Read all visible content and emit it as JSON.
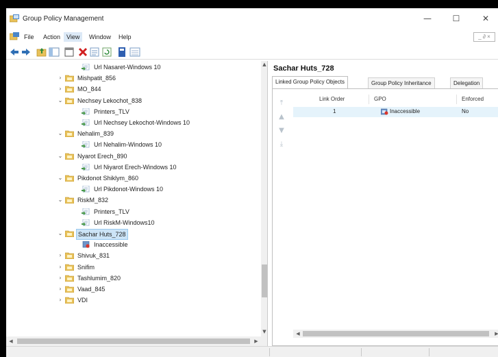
{
  "window": {
    "title": "Group Policy Management",
    "controls": {
      "minimize": "—",
      "maximize": "☐",
      "close": "✕"
    }
  },
  "menu": {
    "items": [
      "File",
      "Action",
      "View",
      "Window",
      "Help"
    ],
    "active": "View",
    "mdi_controls": "_ ∂ ×"
  },
  "toolbar": {
    "buttons": [
      "back-icon",
      "forward-icon",
      "up-folder-icon",
      "show-hide-tree-icon",
      "console-icon",
      "delete-icon",
      "properties-icon",
      "refresh-icon",
      "help-icon",
      "list-view-icon"
    ]
  },
  "tree": {
    "rows": [
      {
        "label": "Url Nasaret-Windows 10",
        "kind": "gpo-link",
        "level": 2,
        "chevron": ""
      },
      {
        "label": "Mishpatit_856",
        "kind": "ou",
        "level": 1,
        "chevron": "›"
      },
      {
        "label": "MO_844",
        "kind": "ou",
        "level": 1,
        "chevron": "›"
      },
      {
        "label": "Nechsey Lekochot_838",
        "kind": "ou",
        "level": 1,
        "chevron": "⌄"
      },
      {
        "label": "Printers_TLV",
        "kind": "gpo-link",
        "level": 2,
        "chevron": ""
      },
      {
        "label": "Url Nechsey Lekochot-Windows 10",
        "kind": "gpo-link",
        "level": 2,
        "chevron": ""
      },
      {
        "label": "Nehalim_839",
        "kind": "ou",
        "level": 1,
        "chevron": "⌄"
      },
      {
        "label": "Url Nehalim-Windows 10",
        "kind": "gpo-link",
        "level": 2,
        "chevron": ""
      },
      {
        "label": "Nyarot Erech_890",
        "kind": "ou",
        "level": 1,
        "chevron": "⌄"
      },
      {
        "label": "Url Niyarot Erech-Windows 10",
        "kind": "gpo-link",
        "level": 2,
        "chevron": ""
      },
      {
        "label": "Pikdonot Shiklym_860",
        "kind": "ou",
        "level": 1,
        "chevron": "⌄"
      },
      {
        "label": "Url Pikdonot-Windows 10",
        "kind": "gpo-link",
        "level": 2,
        "chevron": ""
      },
      {
        "label": "RiskM_832",
        "kind": "ou",
        "level": 1,
        "chevron": "⌄"
      },
      {
        "label": "Printers_TLV",
        "kind": "gpo-link",
        "level": 2,
        "chevron": ""
      },
      {
        "label": "Url RiskM-Windows10",
        "kind": "gpo-link",
        "level": 2,
        "chevron": ""
      },
      {
        "label": "Sachar Huts_728",
        "kind": "ou",
        "level": 1,
        "chevron": "⌄",
        "selected": true
      },
      {
        "label": "Inaccessible",
        "kind": "gpo-inaccessible",
        "level": 2,
        "chevron": ""
      },
      {
        "label": "Shivuk_831",
        "kind": "ou",
        "level": 1,
        "chevron": "›"
      },
      {
        "label": "Snifim",
        "kind": "ou",
        "level": 1,
        "chevron": "›"
      },
      {
        "label": "Tashlumim_820",
        "kind": "ou",
        "level": 1,
        "chevron": "›"
      },
      {
        "label": "Vaad_845",
        "kind": "ou",
        "level": 1,
        "chevron": "›"
      },
      {
        "label": "VDI",
        "kind": "ou",
        "level": 1,
        "chevron": "›"
      }
    ]
  },
  "details": {
    "title": "Sachar Huts_728",
    "tabs": [
      "Linked Group Policy Objects",
      "Group Policy Inheritance",
      "Delegation"
    ],
    "active_tab": "Linked Group Policy Objects",
    "columns": [
      "Link Order",
      "GPO",
      "Enforced"
    ],
    "rows": [
      {
        "link_order": "1",
        "gpo": "Inaccessible",
        "enforced": "No"
      }
    ],
    "order_buttons": [
      "move-top-icon",
      "move-up-icon",
      "move-down-icon",
      "move-bottom-icon"
    ]
  },
  "colors": {
    "folder": "#e8c15a",
    "selection": "#cce4f7",
    "row_highlight": "#e5f3fb",
    "error": "#d9352b"
  }
}
